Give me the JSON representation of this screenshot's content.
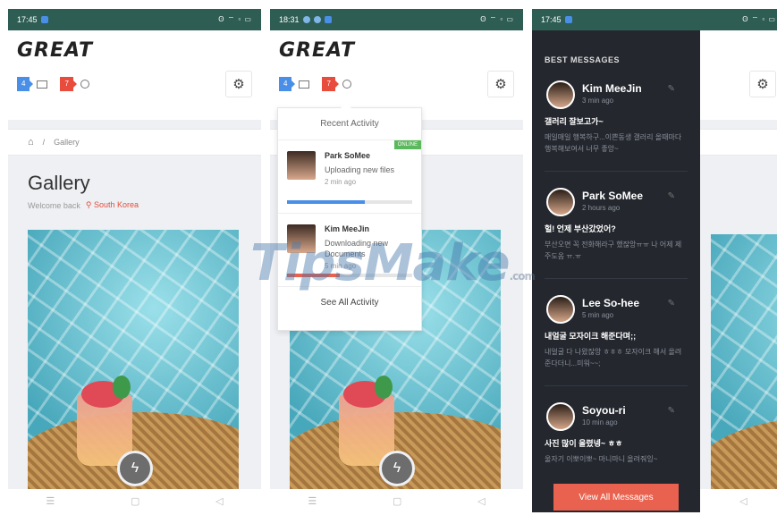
{
  "status": {
    "time_a": "17:45",
    "time_b": "18:31",
    "time_c": "17:45",
    "right": "ʘ ⌔ ▫ ▭"
  },
  "app": {
    "logo": "GREAT",
    "mail_badge": "4",
    "alert_badge": "7"
  },
  "breadcrumb": {
    "current": "Gallery"
  },
  "page": {
    "title": "Gallery",
    "welcome": "Welcome back",
    "location": "South Korea"
  },
  "activity": {
    "title": "Recent Activity",
    "items": [
      {
        "name": "Park SoMee",
        "text": "Uploading new files",
        "time": "2 min ago",
        "tag": "ONLINE",
        "progress": 0.62,
        "progress_color": "#4a8fe7"
      },
      {
        "name": "Kim MeeJin",
        "text": "Downloading new Documents",
        "time": "5 min ago",
        "progress": 0.42,
        "progress_color": "#e8624f"
      }
    ],
    "footer": "See All Activity"
  },
  "messages": {
    "header": "BEST MESSAGES",
    "items": [
      {
        "name": "Kim MeeJin",
        "time": "3 min ago",
        "subject": "갤러리 잘보고가~",
        "body": "매일매일 행복하구...이쁜동생 갤러리 올때마다 행복해보여서 너무 좋앙~"
      },
      {
        "name": "Park SoMee",
        "time": "2 hours ago",
        "subject": "헐! 언제 부산갔었어?",
        "body": "부산오면 꼭 전화해라구 했잖앙ㅠㅠ 나 어제 제주도옴 ㅠ.ㅠ"
      },
      {
        "name": "Lee So-hee",
        "time": "5 min ago",
        "subject": "내얼굴 모자이크 해준다며;;",
        "body": "내얼굴 다 나왔잖앙 ㅎㅎㅎ 모자이크 해서 올려준다더니...미워~~;"
      },
      {
        "name": "Soyou-ri",
        "time": "10 min ago",
        "subject": "사진 많이 올렸넹~ ㅎㅎ",
        "body": "울자기 이뽀이뽀~ 마니마니 올려줘잉~"
      }
    ],
    "view_all": "View All Messages"
  },
  "nav": {
    "menu": "☰",
    "home": "▢",
    "back": "◁"
  },
  "icons": {
    "gear": "⚙",
    "home": "⌂",
    "bolt": "ϟ",
    "pin": "✎",
    "location": "⚲"
  },
  "watermark": {
    "text": "TipsMake",
    "sub": ".com"
  },
  "colors": {
    "status_bar": "#2e5d54",
    "accent_blue": "#4a8fe7",
    "accent_red": "#e74c3c",
    "panel_dark": "#24272e",
    "view_all": "#e8624f",
    "online": "#5cb85c"
  }
}
